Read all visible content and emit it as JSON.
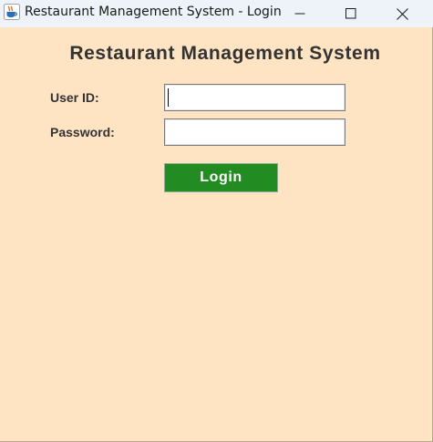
{
  "window": {
    "title": "Restaurant Management System - Login"
  },
  "titlebar_icons": {
    "app": "java-coffee-cup-icon",
    "minimize": "minimize-icon",
    "maximize": "maximize-icon",
    "close": "close-icon"
  },
  "form": {
    "heading": "Restaurant Management System",
    "user_id_label": "User ID:",
    "user_id_value": "",
    "password_label": "Password:",
    "password_value": "",
    "login_label": "Login"
  },
  "colors": {
    "background": "#ffe4c4",
    "heading_text": "#333333",
    "login_button": "#228b22",
    "login_text": "#ffffff"
  }
}
